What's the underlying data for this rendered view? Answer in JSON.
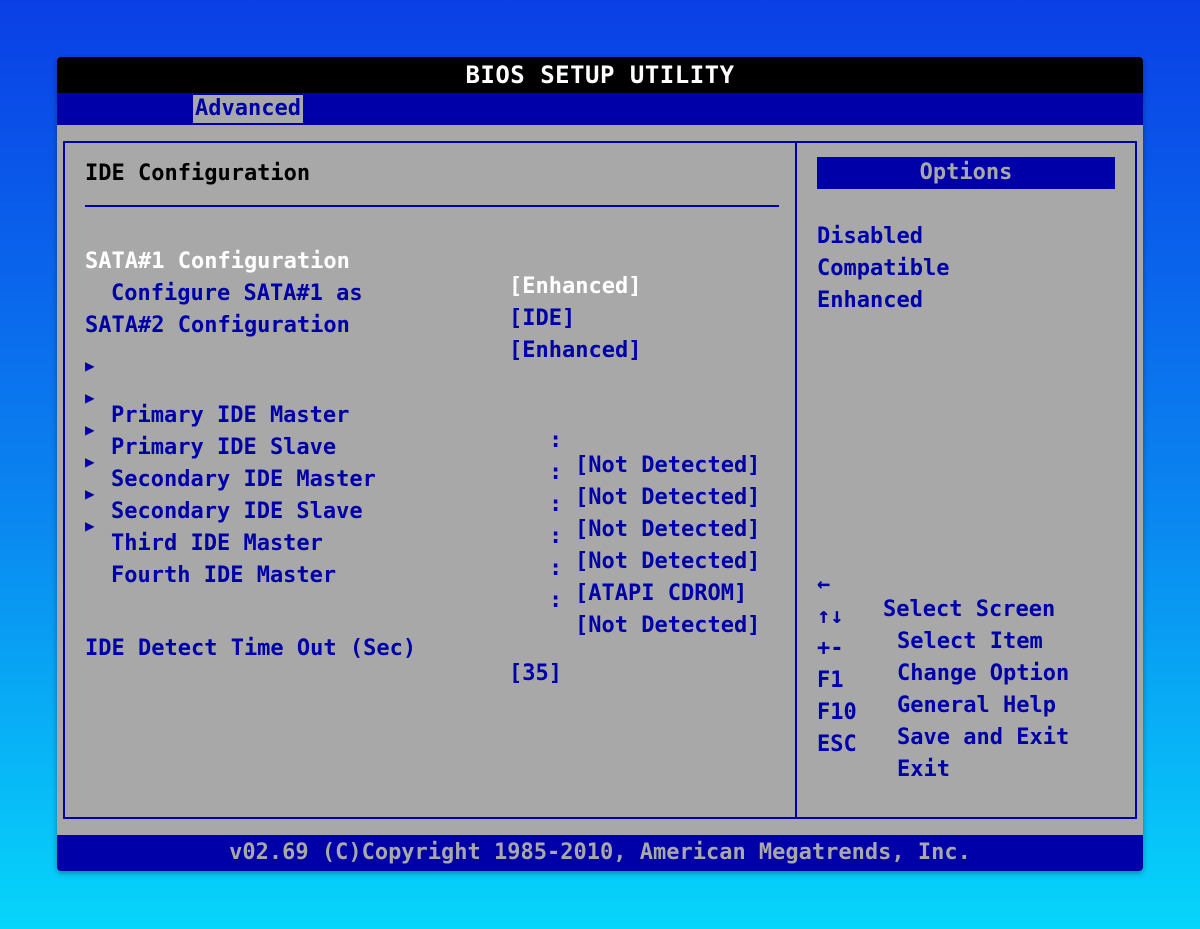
{
  "title": "BIOS SETUP UTILITY",
  "menu": {
    "active_tab": "Advanced"
  },
  "main": {
    "heading": "IDE Configuration",
    "settings": [
      {
        "label": "SATA#1 Configuration",
        "value": "[Enhanced]"
      },
      {
        "label": "Configure SATA#1 as",
        "value": "[IDE]"
      },
      {
        "label": "SATA#2 Configuration",
        "value": "[Enhanced]"
      }
    ],
    "submenus": [
      {
        "label": "Primary IDE Master",
        "value": "[Not Detected]"
      },
      {
        "label": "Primary IDE Slave",
        "value": "[Not Detected]"
      },
      {
        "label": "Secondary IDE Master",
        "value": "[Not Detected]"
      },
      {
        "label": "Secondary IDE Slave",
        "value": "[Not Detected]"
      },
      {
        "label": "Third IDE Master",
        "value": "[ATAPI CDROM]"
      },
      {
        "label": "Fourth IDE Master",
        "value": "[Not Detected]"
      }
    ],
    "timeout": {
      "label": "IDE Detect Time Out (Sec)",
      "value": "[35]"
    },
    "submenu_arrow": "▶",
    "separator": ":"
  },
  "options": {
    "header": "Options",
    "items": [
      "Disabled",
      "Compatible",
      "Enhanced"
    ]
  },
  "keys": [
    {
      "key": "←",
      "desc": "Select Screen"
    },
    {
      "key": "↑↓",
      "desc": "Select Item"
    },
    {
      "key": "+-",
      "desc": "Change Option"
    },
    {
      "key": "F1",
      "desc": "General Help"
    },
    {
      "key": "F10",
      "desc": "Save and Exit"
    },
    {
      "key": "ESC",
      "desc": "Exit"
    }
  ],
  "footer": "v02.69 (C)Copyright 1985-2010, American Megatrends, Inc.",
  "colors": {
    "bios_blue": "#0000a8",
    "bios_gray": "#a8a8a8",
    "background_top": "#0a3fe6",
    "background_bottom": "#06d6fb"
  }
}
